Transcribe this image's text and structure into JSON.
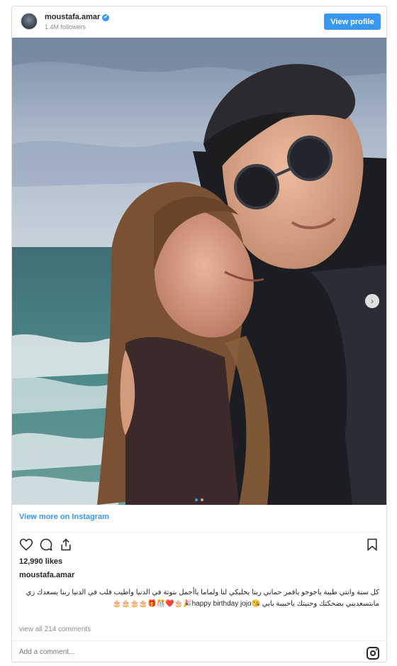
{
  "header": {
    "username": "moustafa.amar",
    "verified_glyph": "✔",
    "followers": "1.4M followers",
    "view_profile_label": "View profile"
  },
  "photo": {
    "next_arrow_glyph": "›",
    "carousel_dots": 2,
    "active_dot": 0
  },
  "view_more_label": "View more on Instagram",
  "actions": {
    "icons": [
      "heart-icon",
      "comment-icon",
      "share-icon",
      "bookmark-icon"
    ]
  },
  "likes": "12,990 likes",
  "caption": {
    "owner": "moustafa.amar",
    "text": "كل سنة وانتي طيبة ياجوجو ياقمر حماني ربنا يخليكي لنا ولماما ياأجمل بنوتة في الدنيا واطيب قلب في الدنيا ربنا يسعدك زي مابتسعديني بضحكتك وحنيتك ياحبيبة بابي 😘happy birthday jojo🎉🎂❤️🎊🎁🎂🎂🎂🎂"
  },
  "comments_link": "view all 214 comments",
  "add_comment_placeholder": "Add a comment...",
  "colors": {
    "accent": "#3897f0",
    "text": "#262626",
    "muted": "#8e8e8e",
    "border": "#dbdbdb"
  }
}
